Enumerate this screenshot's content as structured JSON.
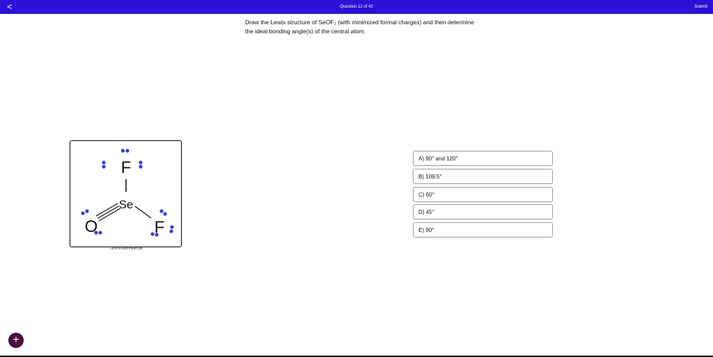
{
  "header": {
    "back_icon": "<",
    "question_count": "Question 12 of 42",
    "submit_label": "Submit"
  },
  "question": {
    "text": "Draw the Lewis structure of SeOF₂ (with minimized formal charges) and then determine the ideal bonding angle(s) of the central atom."
  },
  "molecule": {
    "atoms": {
      "top_f": "F",
      "center": "Se",
      "left_o": "O",
      "right_f": "F"
    },
    "caption": "Click to edit molecule",
    "colors": {
      "lone_pair": "#3a3ad6",
      "bond": "#111111"
    }
  },
  "choices": [
    {
      "label": "A) 90° and 120°"
    },
    {
      "label": "B) 109.5°"
    },
    {
      "label": "C) 60°"
    },
    {
      "label": "D) 45°"
    },
    {
      "label": "E) 90°"
    }
  ],
  "fab": {
    "icon": "+"
  },
  "colors": {
    "header_bg": "#2c12d8",
    "fab_bg": "#4a0a3a"
  }
}
